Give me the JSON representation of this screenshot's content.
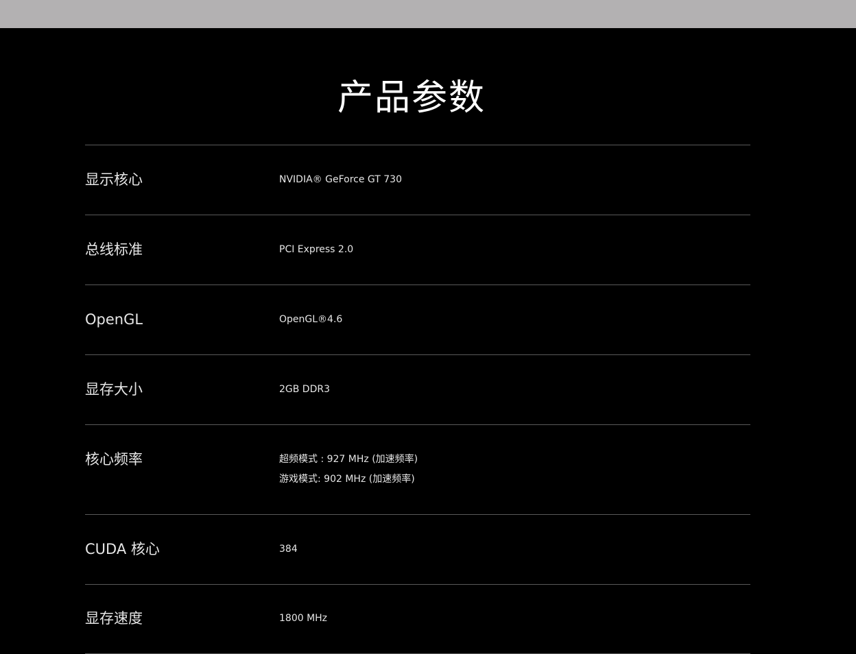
{
  "page": {
    "title": "产品参数"
  },
  "specs": [
    {
      "label": "显示核心",
      "value": "NVIDIA® GeForce GT 730"
    },
    {
      "label": "总线标准",
      "value": "PCI Express 2.0"
    },
    {
      "label": "OpenGL",
      "value": "OpenGL®4.6"
    },
    {
      "label": "显存大小",
      "value": "2GB DDR3"
    },
    {
      "label": "核心频率",
      "value_line1": "超频模式 : 927 MHz (加速频率)",
      "value_line2": "游戏模式: 902 MHz (加速频率)"
    },
    {
      "label": "CUDA 核心",
      "value": "384"
    },
    {
      "label": "显存速度",
      "value": "1800 MHz"
    }
  ],
  "colors": {
    "top_bar": "#b3b1b2",
    "background": "#000000",
    "text": "#e6e6e6",
    "divider": "#5a5a5a"
  }
}
